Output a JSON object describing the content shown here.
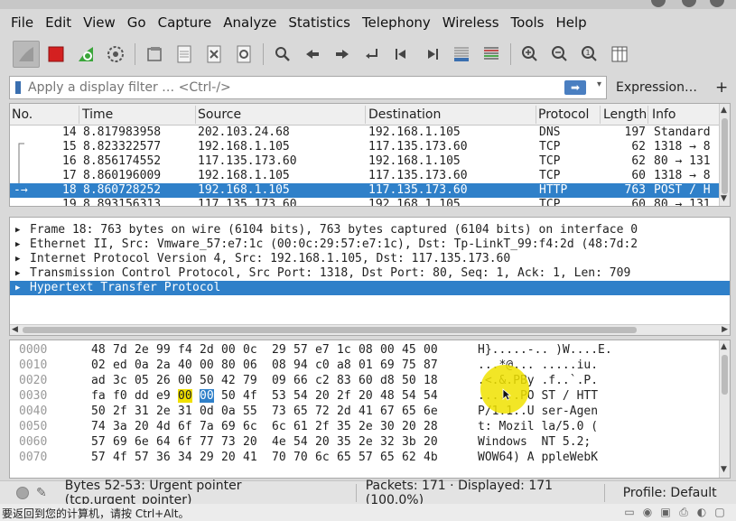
{
  "window": {
    "title": ""
  },
  "menu": {
    "items": [
      {
        "label": "File"
      },
      {
        "label": "Edit"
      },
      {
        "label": "View"
      },
      {
        "label": "Go"
      },
      {
        "label": "Capture"
      },
      {
        "label": "Analyze"
      },
      {
        "label": "Statistics"
      },
      {
        "label": "Telephony"
      },
      {
        "label": "Wireless"
      },
      {
        "label": "Tools"
      },
      {
        "label": "Help"
      }
    ]
  },
  "toolbar": {
    "icons": [
      "shark-fin-icon",
      "stop-icon",
      "restart-icon",
      "options-gear-icon",
      "open-folder-icon",
      "file-icon",
      "close-file-icon",
      "reload-icon",
      "search-icon",
      "back-arrow-icon",
      "forward-arrow-icon",
      "go-to-packet-icon",
      "first-packet-icon",
      "last-packet-icon",
      "autoscroll-icon",
      "colorize-icon",
      "zoom-in-icon",
      "zoom-out-icon",
      "zoom-reset-icon",
      "resize-columns-icon"
    ]
  },
  "filter": {
    "placeholder": "Apply a display filter … <Ctrl-/>",
    "expression_label": "Expression…",
    "plus_label": "+"
  },
  "packet_list": {
    "columns": {
      "no": "No.",
      "time": "Time",
      "source": "Source",
      "destination": "Destination",
      "protocol": "Protocol",
      "length": "Length",
      "info": "Info"
    },
    "rows": [
      {
        "no": "14",
        "time": "8.817983958",
        "source": "202.103.24.68",
        "destination": "192.168.1.105",
        "protocol": "DNS",
        "length": "197",
        "info": "Standard"
      },
      {
        "no": "15",
        "time": "8.823322577",
        "source": "192.168.1.105",
        "destination": "117.135.173.60",
        "protocol": "TCP",
        "length": "62",
        "info": "1318 → 8"
      },
      {
        "no": "16",
        "time": "8.856174552",
        "source": "117.135.173.60",
        "destination": "192.168.1.105",
        "protocol": "TCP",
        "length": "62",
        "info": "80 → 131"
      },
      {
        "no": "17",
        "time": "8.860196009",
        "source": "192.168.1.105",
        "destination": "117.135.173.60",
        "protocol": "TCP",
        "length": "60",
        "info": "1318 → 8"
      },
      {
        "no": "18",
        "time": "8.860728252",
        "source": "192.168.1.105",
        "destination": "117.135.173.60",
        "protocol": "HTTP",
        "length": "763",
        "info": "POST / H"
      },
      {
        "no": "19",
        "time": "8.893156313",
        "source": "117.135.173.60",
        "destination": "192.168.1.105",
        "protocol": "TCP",
        "length": "60",
        "info": "80 → 131"
      }
    ]
  },
  "details": {
    "lines": [
      {
        "text": "Frame 18: 763 bytes on wire (6104 bits), 763 bytes captured (6104 bits) on interface 0"
      },
      {
        "text": "Ethernet II, Src: Vmware_57:e7:1c (00:0c:29:57:e7:1c), Dst: Tp-LinkT_99:f4:2d (48:7d:2"
      },
      {
        "text": "Internet Protocol Version 4, Src: 192.168.1.105, Dst: 117.135.173.60"
      },
      {
        "text": "Transmission Control Protocol, Src Port: 1318, Dst Port: 80, Seq: 1, Ack: 1, Len: 709"
      },
      {
        "text": "Hypertext Transfer Protocol"
      }
    ]
  },
  "bytes": {
    "rows": [
      {
        "offset": "0000",
        "hex": [
          "48",
          "7d",
          "2e",
          "99",
          "f4",
          "2d",
          "00",
          "0c",
          "29",
          "57",
          "e7",
          "1c",
          "08",
          "00",
          "45",
          "00"
        ],
        "ascii": "H}.....-.. )W....E."
      },
      {
        "offset": "0010",
        "hex": [
          "02",
          "ed",
          "0a",
          "2a",
          "40",
          "00",
          "80",
          "06",
          "08",
          "94",
          "c0",
          "a8",
          "01",
          "69",
          "75",
          "87"
        ],
        "ascii": "...*@... .....iu."
      },
      {
        "offset": "0020",
        "hex": [
          "ad",
          "3c",
          "05",
          "26",
          "00",
          "50",
          "42",
          "79",
          "09",
          "66",
          "c2",
          "83",
          "60",
          "d8",
          "50",
          "18"
        ],
        "ascii": ".<.&.PBy .f..`.P."
      },
      {
        "offset": "0030",
        "hex": [
          "fa",
          "f0",
          "dd",
          "e9",
          "00",
          "00",
          "50",
          "4f",
          "53",
          "54",
          "20",
          "2f",
          "20",
          "48",
          "54",
          "54"
        ],
        "ascii": "......PO ST / HTT"
      },
      {
        "offset": "0040",
        "hex": [
          "50",
          "2f",
          "31",
          "2e",
          "31",
          "0d",
          "0a",
          "55",
          "73",
          "65",
          "72",
          "2d",
          "41",
          "67",
          "65",
          "6e"
        ],
        "ascii": "P/1.1..U ser-Agen"
      },
      {
        "offset": "0050",
        "hex": [
          "74",
          "3a",
          "20",
          "4d",
          "6f",
          "7a",
          "69",
          "6c",
          "6c",
          "61",
          "2f",
          "35",
          "2e",
          "30",
          "20",
          "28"
        ],
        "ascii": "t: Mozil la/5.0 ("
      },
      {
        "offset": "0060",
        "hex": [
          "57",
          "69",
          "6e",
          "64",
          "6f",
          "77",
          "73",
          "20",
          "4e",
          "54",
          "20",
          "35",
          "2e",
          "32",
          "3b",
          "20"
        ],
        "ascii": "Windows  NT 5.2;"
      },
      {
        "offset": "0070",
        "hex": [
          "57",
          "4f",
          "57",
          "36",
          "34",
          "29",
          "20",
          "41",
          "70",
          "70",
          "6c",
          "65",
          "57",
          "65",
          "62",
          "4b"
        ],
        "ascii": "WOW64) A ppleWebK"
      }
    ]
  },
  "status": {
    "field": "Bytes 52-53: Urgent pointer (tcp.urgent_pointer)",
    "packets": "Packets: 171 · Displayed: 171 (100.0%)",
    "profile": "Profile: Default"
  },
  "taskbar": {
    "hint": "要返回到您的计算机，请按 Ctrl+Alt。"
  },
  "colors": {
    "selection": "#2f80c9",
    "highlight": "#f0e000",
    "stop": "#d42020",
    "restart": "#3aa53a"
  }
}
